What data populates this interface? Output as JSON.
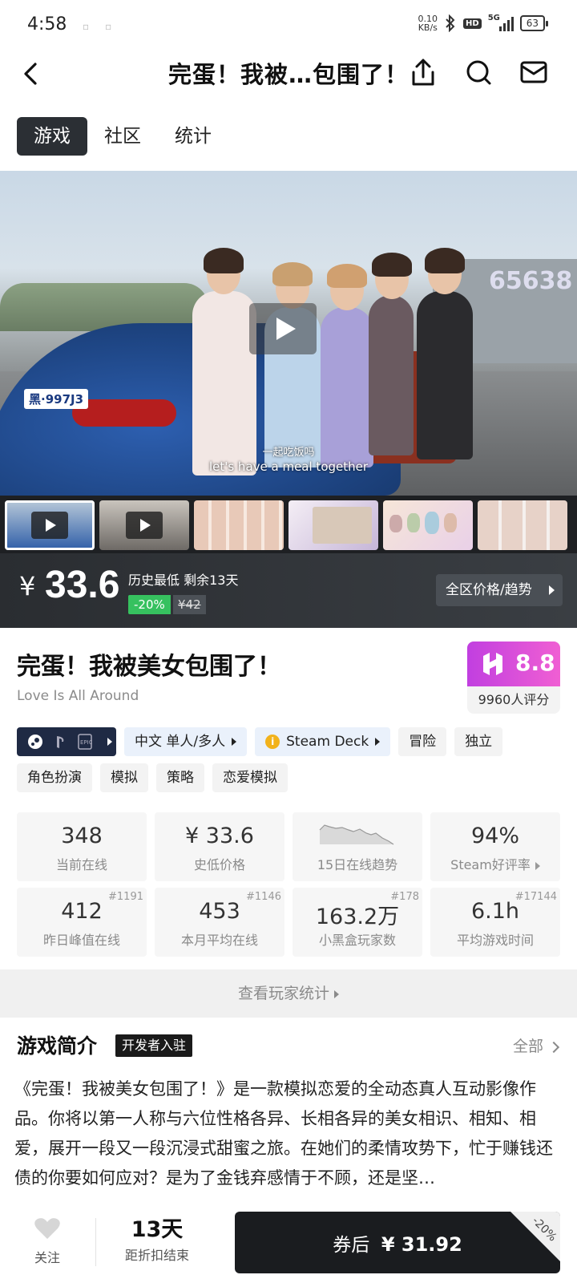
{
  "status_bar": {
    "time": "4:58",
    "net_speed_value": "0.10",
    "net_speed_unit": "KB/s",
    "hd": "HD",
    "network": "5G",
    "battery": "63"
  },
  "header": {
    "title": "完蛋！我被…包围了！"
  },
  "tabs": [
    {
      "label": "游戏",
      "active": true
    },
    {
      "label": "社区",
      "active": false
    },
    {
      "label": "统计",
      "active": false
    }
  ],
  "video": {
    "subtitle_cn": "一起吃饭吗",
    "subtitle_en": "let's have a meal together",
    "plate": "黑·997J3",
    "building_sign": "65638"
  },
  "price": {
    "currency": "¥",
    "current": "33.6",
    "note": "历史最低 剩余13天",
    "discount": "-20%",
    "original": "¥42",
    "region_button": "全区价格/趋势"
  },
  "game": {
    "title": "完蛋！我被美女包围了！",
    "subtitle": "Love Is All Around",
    "score": "8.8",
    "score_count": "9960人评分"
  },
  "tags_row1": [
    {
      "label": "中文  单人/多人",
      "style": "blue",
      "arrow": true
    },
    {
      "label": "Steam Deck",
      "style": "blue",
      "arrow": true,
      "icon": "info-coin-icon"
    },
    {
      "label": "冒险",
      "style": "gray",
      "arrow": false
    },
    {
      "label": "独立",
      "style": "gray",
      "arrow": false
    }
  ],
  "tags_row2": [
    {
      "label": "角色扮演"
    },
    {
      "label": "模拟"
    },
    {
      "label": "策略"
    },
    {
      "label": "恋爱模拟"
    }
  ],
  "stats": [
    {
      "value": "348",
      "label": "当前在线",
      "rank": ""
    },
    {
      "value": "¥ 33.6",
      "label": "史低价格",
      "rank": ""
    },
    {
      "value": "",
      "label": "15日在线趋势",
      "rank": ""
    },
    {
      "value": "94%",
      "label": "Steam好评率",
      "rank": ""
    },
    {
      "value": "412",
      "label": "昨日峰值在线",
      "rank": "#1191"
    },
    {
      "value": "453",
      "label": "本月平均在线",
      "rank": "#1146"
    },
    {
      "value": "163.2万",
      "label": "小黑盒玩家数",
      "rank": "#178"
    },
    {
      "value": "6.1h",
      "label": "平均游戏时间",
      "rank": "#17144"
    }
  ],
  "view_stats": "查看玩家统计",
  "intro": {
    "heading": "游戏简介",
    "badge": "开发者入驻",
    "all_link": "全部",
    "text": "《完蛋！我被美女包围了！》是一款模拟恋爱的全动态真人互动影像作品。你将以第一人称与六位性格各异、长相各异的美女相识、相知、相爱，展开一段又一段沉浸式甜蜜之旅。在她们的柔情攻势下，忙于赚钱还债的你要如何应对？是为了金钱弃感情于不顾，还是坚…"
  },
  "bottom": {
    "follow_label": "关注",
    "days": "13天",
    "days_label": "距折扣结束",
    "buy_prefix": "券后",
    "buy_price": "¥ 31.92",
    "corner_discount": "-20%"
  },
  "colors": {
    "accent_dark": "#2b2f34",
    "discount_green": "#36c15f",
    "score_pink": "#e04fd8"
  }
}
